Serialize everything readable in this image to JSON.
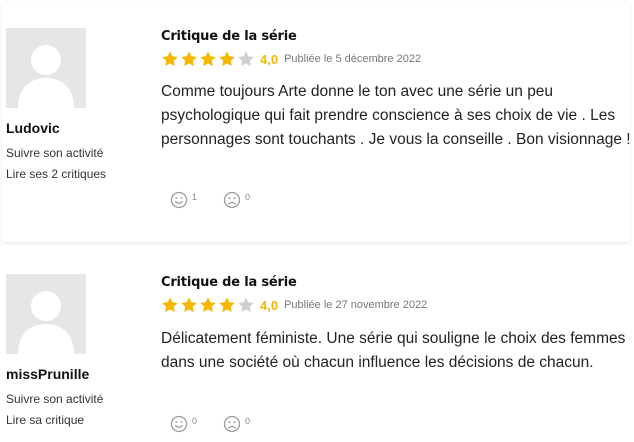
{
  "reviews": [
    {
      "username": "Ludovic",
      "follow_label": "Suivre son activité",
      "reviews_link": "Lire ses 2 critiques",
      "critique_title": "Critique de la série",
      "rating": "4,0",
      "rating_stars": 4,
      "date": "Publiée le 5 décembre 2022",
      "body": "Comme toujours Arte donne le ton avec une série un peu psychologique qui fait prendre conscience à ses choix de vie . Les personnages sont touchants . Je vous la conseille . Bon visionnage !",
      "helpful_count": "1",
      "unhelpful_count": "0"
    },
    {
      "username": "missPrunille",
      "follow_label": "Suivre son activité",
      "reviews_link": "Lire sa critique",
      "critique_title": "Critique de la série",
      "rating": "4,0",
      "rating_stars": 4,
      "date": "Publiée le 27 novembre 2022",
      "body": "Délicatement féministe. Une série qui souligne le choix des femmes dans une société où chacun influence les décisions de chacun.",
      "helpful_count": "0",
      "unhelpful_count": "0"
    }
  ],
  "colors": {
    "star_filled": "#f5b700",
    "star_empty": "#cfcfcf",
    "avatar_bg": "#e6e6e6",
    "avatar_fg": "#ffffff"
  },
  "icons": {
    "helpful": "smiley-icon",
    "unhelpful": "sad-face-icon",
    "avatar": "default-user-avatar-icon",
    "star": "star-icon"
  }
}
